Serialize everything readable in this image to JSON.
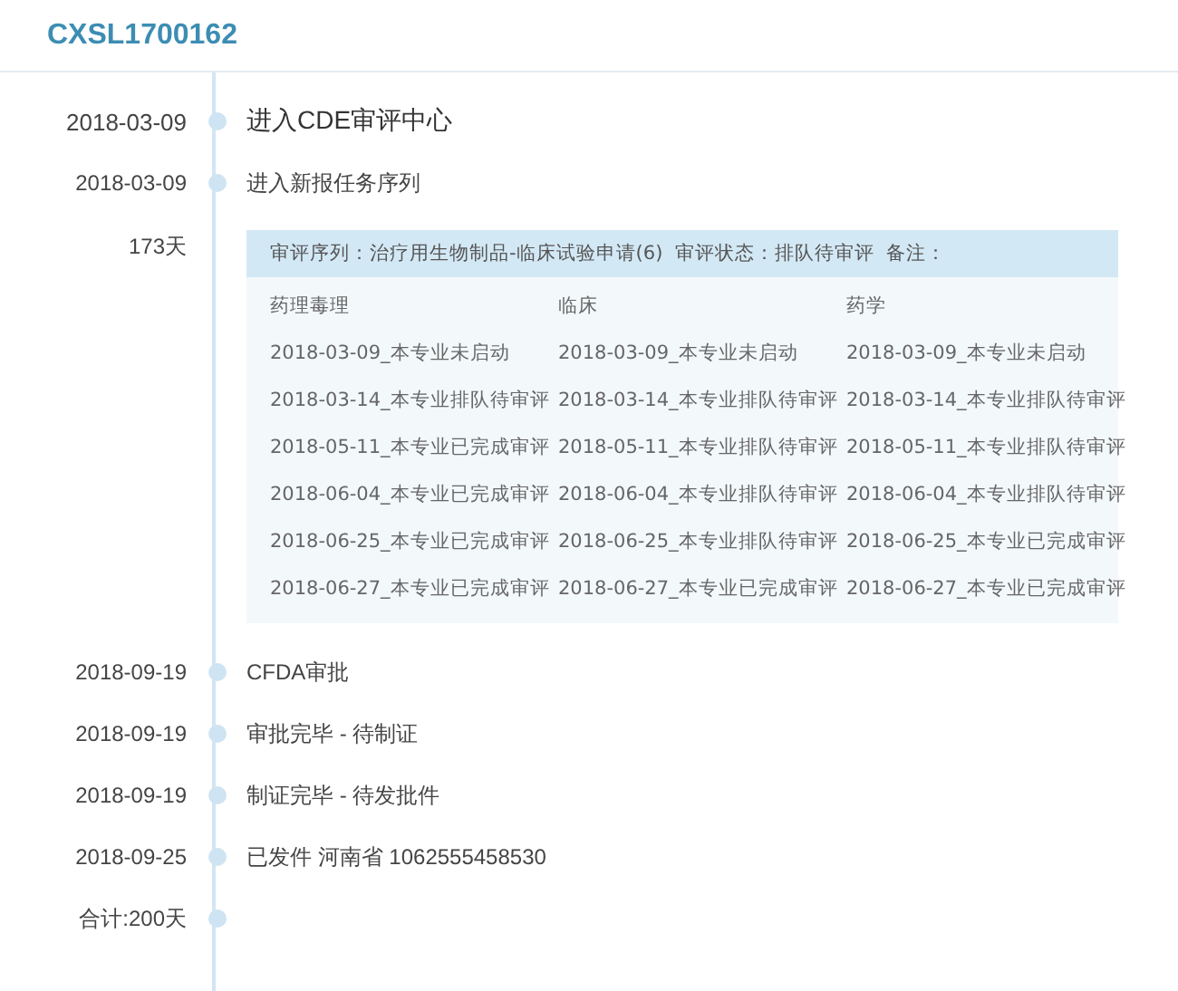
{
  "title": "CXSL1700162",
  "timeline": [
    {
      "kind": "major",
      "date": "2018-03-09",
      "text": "进入CDE审评中心"
    },
    {
      "kind": "event",
      "date": "2018-03-09",
      "text": "进入新报任务序列"
    },
    {
      "kind": "review",
      "date": "173天",
      "summary": "审评序列：治疗用生物制品-临床试验申请(6)  审评状态：排队待审评  备注：",
      "columns": [
        "药理毒理",
        "临床",
        "药学"
      ],
      "rows": [
        [
          "2018-03-09_本专业未启动",
          "2018-03-09_本专业未启动",
          "2018-03-09_本专业未启动"
        ],
        [
          "2018-03-14_本专业排队待审评",
          "2018-03-14_本专业排队待审评",
          "2018-03-14_本专业排队待审评"
        ],
        [
          "2018-05-11_本专业已完成审评",
          "2018-05-11_本专业排队待审评",
          "2018-05-11_本专业排队待审评"
        ],
        [
          "2018-06-04_本专业已完成审评",
          "2018-06-04_本专业排队待审评",
          "2018-06-04_本专业排队待审评"
        ],
        [
          "2018-06-25_本专业已完成审评",
          "2018-06-25_本专业排队待审评",
          "2018-06-25_本专业已完成审评"
        ],
        [
          "2018-06-27_本专业已完成审评",
          "2018-06-27_本专业已完成审评",
          "2018-06-27_本专业已完成审评"
        ]
      ]
    },
    {
      "kind": "event",
      "date": "2018-09-19",
      "text": "CFDA审批"
    },
    {
      "kind": "event",
      "date": "2018-09-19",
      "text": "审批完毕 - 待制证"
    },
    {
      "kind": "event",
      "date": "2018-09-19",
      "text": "制证完毕 - 待发批件"
    },
    {
      "kind": "event",
      "date": "2018-09-25",
      "text": "已发件 河南省 1062555458530"
    },
    {
      "kind": "total",
      "date": "合计:200天"
    }
  ]
}
